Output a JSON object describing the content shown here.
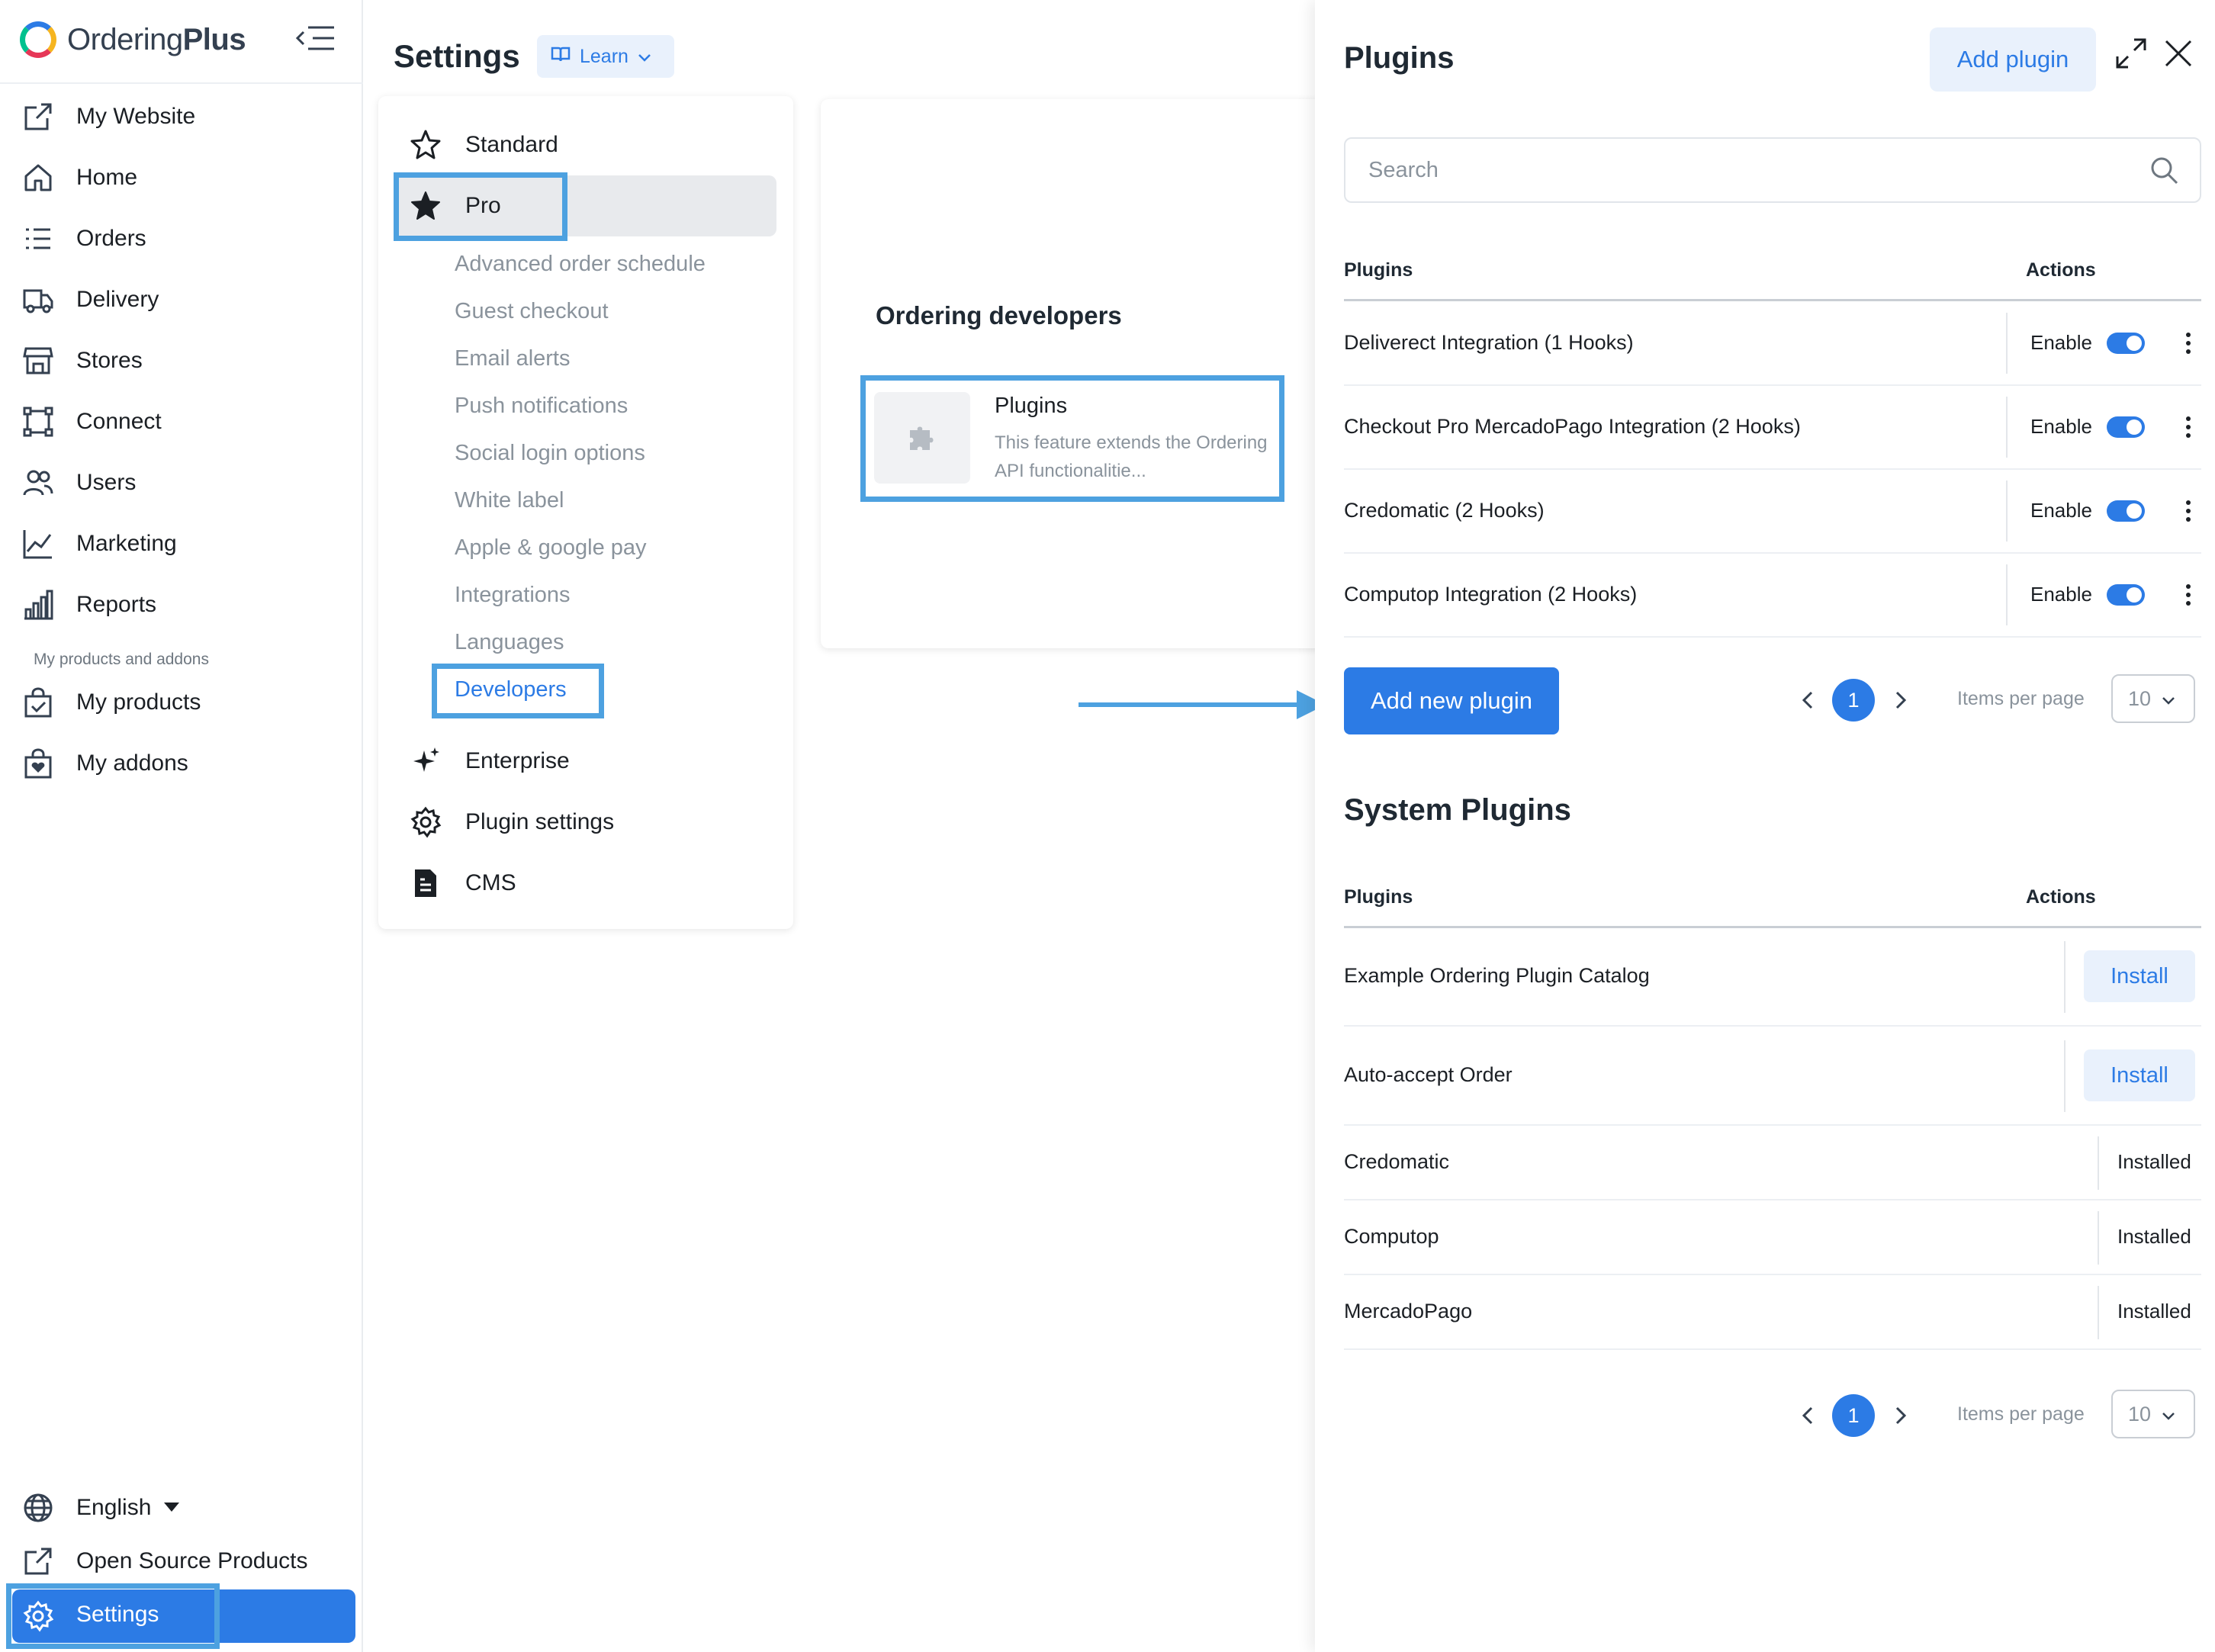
{
  "brand": {
    "name_light": "Ordering",
    "name_bold": "Plus"
  },
  "sidebar": {
    "items": [
      {
        "label": "My Website",
        "icon": "external-link-icon"
      },
      {
        "label": "Home",
        "icon": "home-icon"
      },
      {
        "label": "Orders",
        "icon": "list-icon"
      },
      {
        "label": "Delivery",
        "icon": "truck-icon"
      },
      {
        "label": "Stores",
        "icon": "store-icon"
      },
      {
        "label": "Connect",
        "icon": "connect-icon"
      },
      {
        "label": "Users",
        "icon": "users-icon"
      },
      {
        "label": "Marketing",
        "icon": "chart-line-icon"
      },
      {
        "label": "Reports",
        "icon": "bar-chart-icon"
      }
    ],
    "section_label": "My products and addons",
    "products": [
      {
        "label": "My products",
        "icon": "bag-check-icon"
      },
      {
        "label": "My addons",
        "icon": "bag-heart-icon"
      }
    ],
    "language": "English",
    "open_source": "Open Source Products",
    "settings": "Settings"
  },
  "header": {
    "title": "Settings",
    "learn": "Learn"
  },
  "settings_menu": {
    "standard": "Standard",
    "pro": "Pro",
    "pro_items": [
      "Advanced order schedule",
      "Guest checkout",
      "Email alerts",
      "Push notifications",
      "Social login options",
      "White label",
      "Apple & google pay",
      "Integrations",
      "Languages",
      "Developers"
    ],
    "enterprise": "Enterprise",
    "plugin_settings": "Plugin settings",
    "cms": "CMS"
  },
  "developers": {
    "title": "Ordering developers",
    "tile_title": "Plugins",
    "tile_desc": "This feature extends the Ordering API functionalitie..."
  },
  "panel": {
    "title": "Plugins",
    "add_plugin": "Add plugin",
    "search_placeholder": "Search",
    "col_plugins": "Plugins",
    "col_actions": "Actions",
    "enable_label": "Enable",
    "plugins": [
      {
        "name": "Deliverect Integration (1 Hooks)",
        "enabled": true
      },
      {
        "name": "Checkout Pro MercadoPago Integration (2 Hooks)",
        "enabled": true
      },
      {
        "name": "Credomatic (2 Hooks)",
        "enabled": true
      },
      {
        "name": "Computop Integration (2 Hooks)",
        "enabled": true
      }
    ],
    "add_new": "Add new plugin",
    "page": "1",
    "items_per_page_label": "Items per page",
    "items_per_page": "10",
    "system_title": "System Plugins",
    "install_label": "Install",
    "installed_label": "Installed",
    "system_plugins": [
      {
        "name": "Example Ordering Plugin Catalog",
        "status": "install"
      },
      {
        "name": "Auto-accept Order",
        "status": "install"
      },
      {
        "name": "Credomatic",
        "status": "installed"
      },
      {
        "name": "Computop",
        "status": "installed"
      },
      {
        "name": "MercadoPago",
        "status": "installed"
      }
    ]
  },
  "colors": {
    "accent": "#2c7be5",
    "highlight": "#4da1e0"
  }
}
